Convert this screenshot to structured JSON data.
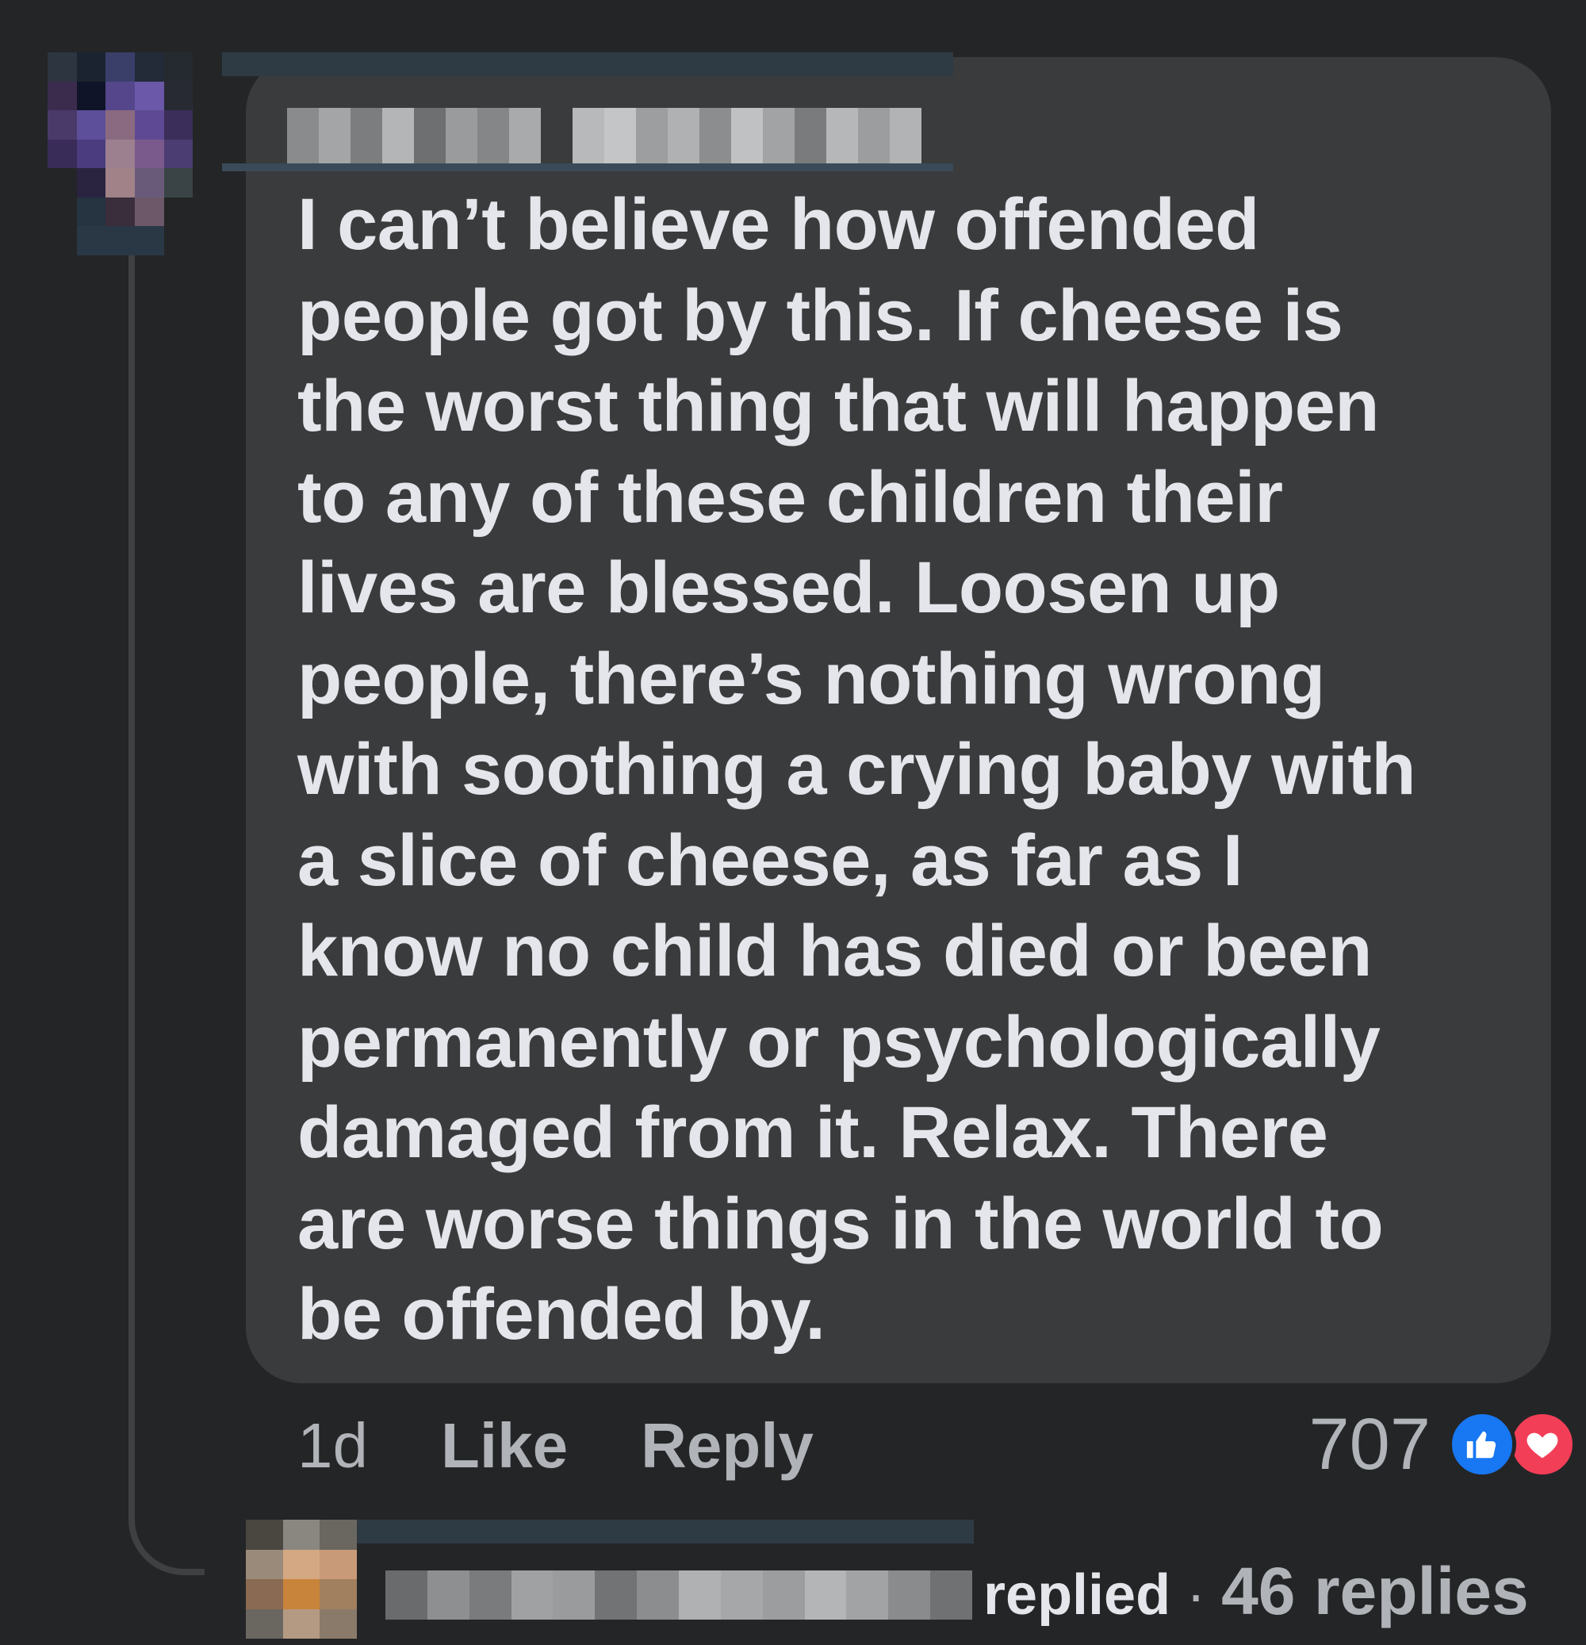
{
  "comment": {
    "text_lines": [
      "I can’t believe how offended",
      "people got by this. If cheese is",
      "the worst thing that will happen",
      "to any of these children their",
      "lives are blessed. Loosen up",
      "people, there’s nothing wrong",
      "with soothing a crying baby with",
      "a slice of cheese, as far as I",
      "know no child has died or been",
      "permanently or psychologically",
      "damaged from it. Relax. There",
      "are worse things in the world to",
      "be offended by."
    ],
    "author_name": ""
  },
  "actions": {
    "time": "1d",
    "like_label": "Like",
    "reply_label": "Reply"
  },
  "reactions": {
    "count": "707",
    "types": [
      "like-icon",
      "love-icon"
    ]
  },
  "reply_summary": {
    "author_name": "",
    "replied_label": "replied",
    "separator": "·",
    "replies_count_label": "46 replies"
  },
  "colors": {
    "background": "#242526",
    "bubble": "#3a3b3c",
    "text": "#e4e6eb",
    "secondary_text": "#b0b3b8",
    "like_blue": "#1877f2",
    "love_red": "#f33e58"
  }
}
